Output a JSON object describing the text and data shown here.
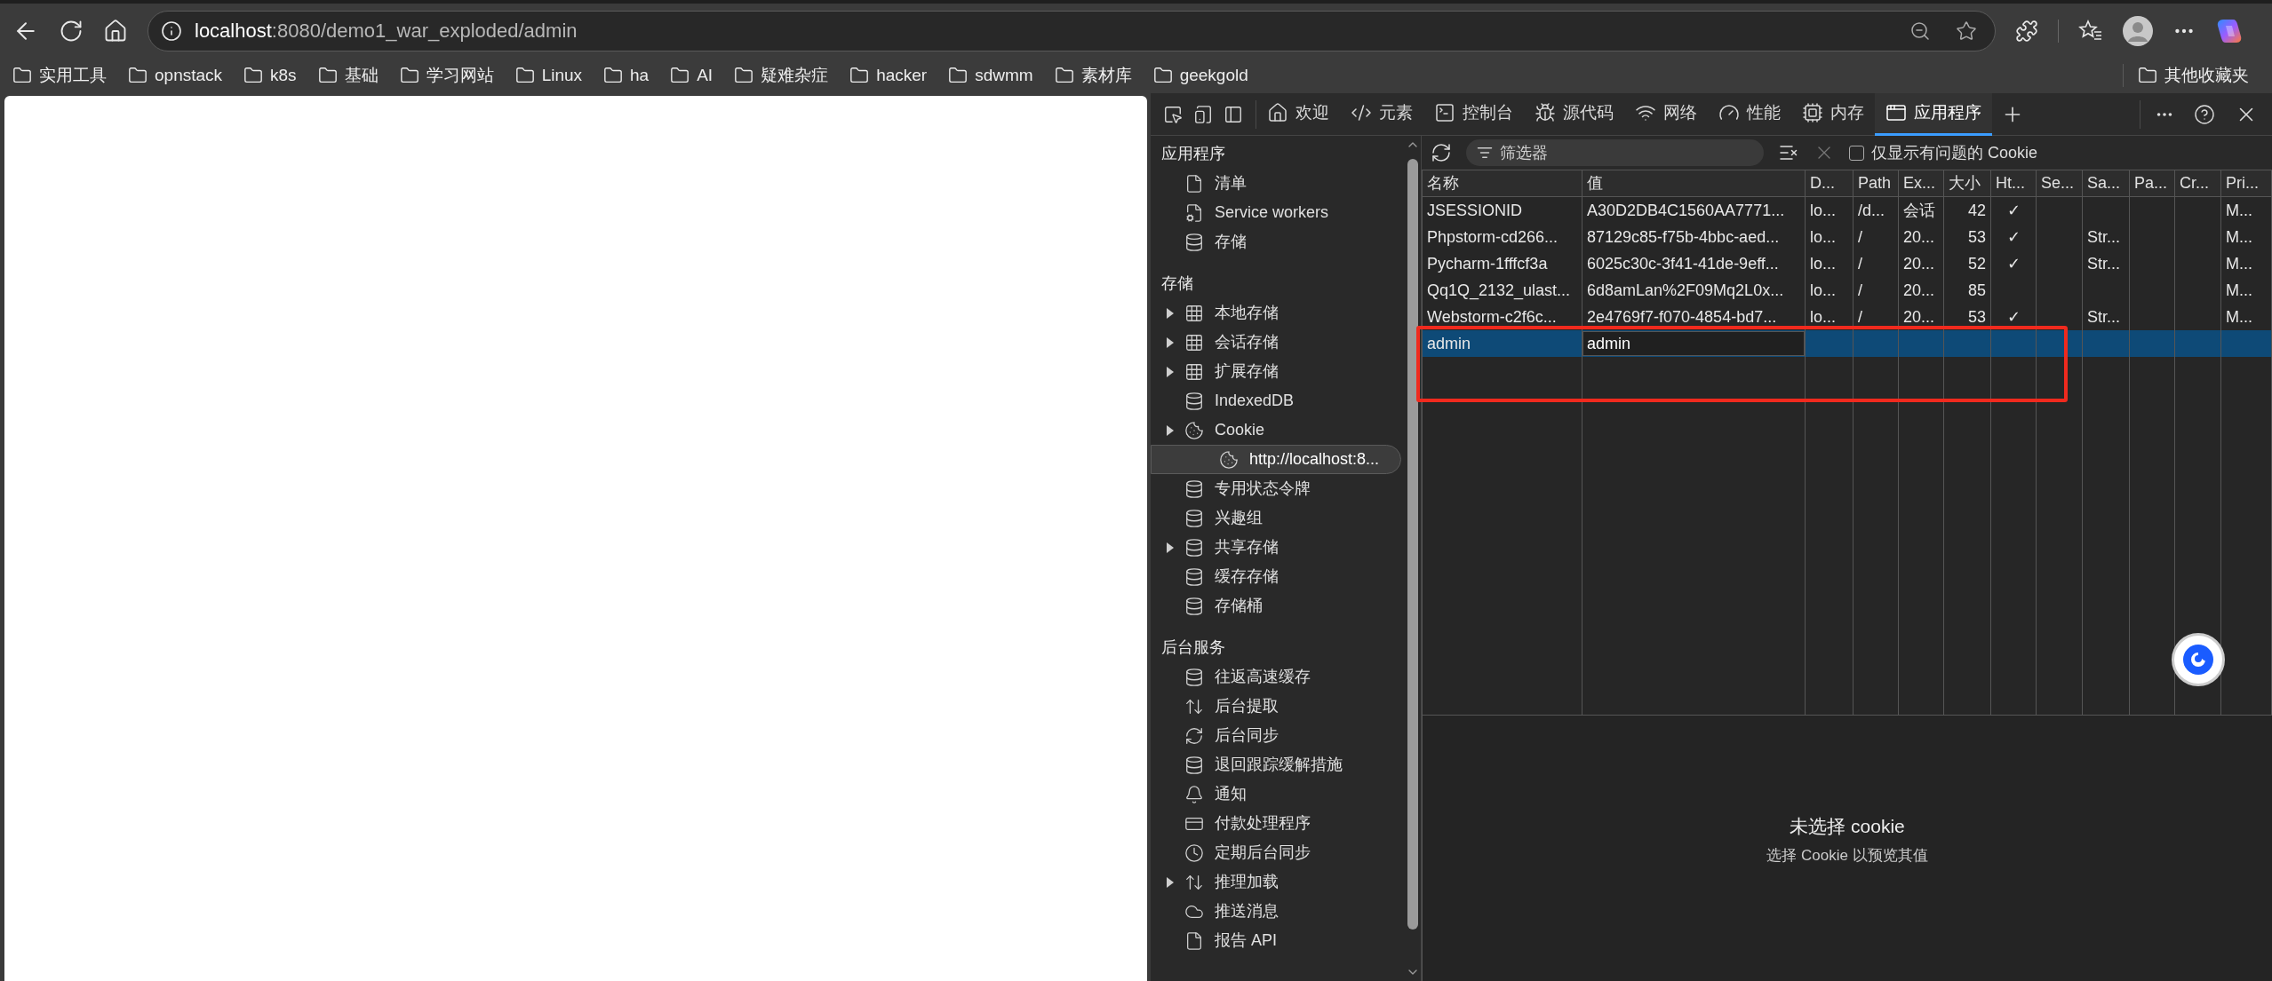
{
  "browser": {
    "url": {
      "host": "localhost",
      "path": ":8080/demo1_war_exploded/admin"
    },
    "bookmarks": [
      "实用工具",
      "opnstack",
      "k8s",
      "基础",
      "学习网站",
      "Linux",
      "ha",
      "AI",
      "疑难杂症",
      "hacker",
      "sdwmm",
      "素材库",
      "geekgold"
    ],
    "other_bookmarks": "其他收藏夹"
  },
  "devtools": {
    "tabs": [
      {
        "label": "欢迎",
        "selected": false
      },
      {
        "label": "元素",
        "selected": false
      },
      {
        "label": "控制台",
        "selected": false
      },
      {
        "label": "源代码",
        "selected": false
      },
      {
        "label": "网络",
        "selected": false
      },
      {
        "label": "性能",
        "selected": false
      },
      {
        "label": "内存",
        "selected": false
      },
      {
        "label": "应用程序",
        "selected": true
      }
    ],
    "sidebar": [
      {
        "title": "应用程序",
        "items": [
          {
            "label": "清单",
            "expandable": false,
            "selected": false
          },
          {
            "label": "Service workers",
            "expandable": false,
            "selected": false
          },
          {
            "label": "存储",
            "expandable": false,
            "selected": false
          }
        ]
      },
      {
        "title": "存储",
        "items": [
          {
            "label": "本地存储",
            "expandable": true,
            "selected": false
          },
          {
            "label": "会话存储",
            "expandable": true,
            "selected": false
          },
          {
            "label": "扩展存储",
            "expandable": true,
            "selected": false
          },
          {
            "label": "IndexedDB",
            "expandable": false,
            "selected": false
          },
          {
            "label": "Cookie",
            "expandable": true,
            "selected": false,
            "children": [
              {
                "label": "http://localhost:8...",
                "expandable": false,
                "selected": true
              }
            ]
          },
          {
            "label": "专用状态令牌",
            "expandable": false,
            "selected": false
          },
          {
            "label": "兴趣组",
            "expandable": false,
            "selected": false
          },
          {
            "label": "共享存储",
            "expandable": true,
            "selected": false
          },
          {
            "label": "缓存存储",
            "expandable": false,
            "selected": false
          },
          {
            "label": "存储桶",
            "expandable": false,
            "selected": false
          }
        ]
      },
      {
        "title": "后台服务",
        "items": [
          {
            "label": "往返高速缓存",
            "expandable": false,
            "selected": false
          },
          {
            "label": "后台提取",
            "expandable": false,
            "selected": false
          },
          {
            "label": "后台同步",
            "expandable": false,
            "selected": false
          },
          {
            "label": "退回跟踪缓解措施",
            "expandable": false,
            "selected": false
          },
          {
            "label": "通知",
            "expandable": false,
            "selected": false
          },
          {
            "label": "付款处理程序",
            "expandable": false,
            "selected": false
          },
          {
            "label": "定期后台同步",
            "expandable": false,
            "selected": false
          },
          {
            "label": "推理加载",
            "expandable": true,
            "selected": false
          },
          {
            "label": "推送消息",
            "expandable": false,
            "selected": false
          },
          {
            "label": "报告 API",
            "expandable": false,
            "selected": false
          }
        ]
      }
    ],
    "cookies": {
      "filter": {
        "placeholder": "筛选器"
      },
      "only_issues": {
        "label": "仅显示有问题的 Cookie",
        "checked": false
      },
      "columns": [
        "名称",
        "值",
        "D...",
        "Path",
        "Ex...",
        "大小",
        "Ht...",
        "Se...",
        "Sa...",
        "Pa...",
        "Cr...",
        "Pri..."
      ],
      "rows": [
        {
          "cells": [
            "JSESSIONID",
            "A30D2DB4C1560AA7771...",
            "lo...",
            "/d...",
            "会话",
            "42",
            "✓",
            "",
            "",
            "",
            "",
            "M..."
          ],
          "selected": false,
          "editing": false
        },
        {
          "cells": [
            "Phpstorm-cd266...",
            "87129c85-f75b-4bbc-aed...",
            "lo...",
            "/",
            "20...",
            "53",
            "✓",
            "",
            "Str...",
            "",
            "",
            "M..."
          ],
          "selected": false,
          "editing": false
        },
        {
          "cells": [
            "Pycharm-1fffcf3a",
            "6025c30c-3f41-41de-9eff...",
            "lo...",
            "/",
            "20...",
            "52",
            "✓",
            "",
            "Str...",
            "",
            "",
            "M..."
          ],
          "selected": false,
          "editing": false
        },
        {
          "cells": [
            "Qq1Q_2132_ulast...",
            "6d8amLan%2F09Mq2L0x...",
            "lo...",
            "/",
            "20...",
            "85",
            "",
            "",
            "",
            "",
            "",
            "M..."
          ],
          "selected": false,
          "editing": false
        },
        {
          "cells": [
            "Webstorm-c2f6c...",
            "2e4769f7-f070-4854-bd7...",
            "lo...",
            "/",
            "20...",
            "53",
            "✓",
            "",
            "Str...",
            "",
            "",
            "M..."
          ],
          "selected": false,
          "editing": false
        },
        {
          "cells": [
            "admin",
            "admin"
          ],
          "selected": true,
          "editing": true
        }
      ],
      "preview": {
        "title": "未选择 cookie",
        "hint": "选择 Cookie 以预览其值"
      }
    }
  }
}
